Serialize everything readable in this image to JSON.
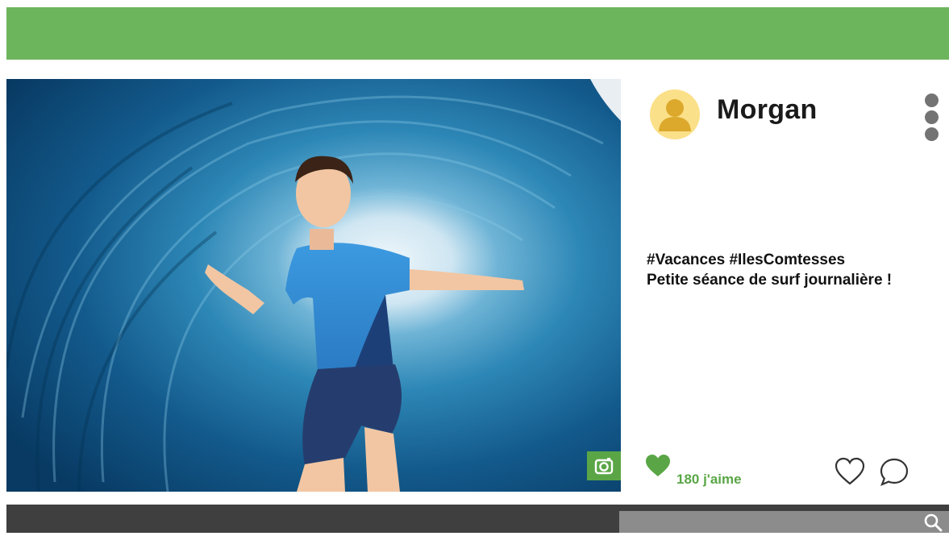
{
  "header": {},
  "post": {
    "author": "Morgan",
    "caption_line1": "#Vacances #IlesComtesses",
    "caption_line2": "Petite séance de surf journalière !",
    "likes_text": "180 j'aime",
    "photo_icon": "camera-icon",
    "avatar_icon": "user-avatar-icon"
  },
  "actions": {
    "like_icon": "heart-filled-icon",
    "favorite_icon": "heart-outline-icon",
    "comment_icon": "comment-bubble-icon",
    "menu_icon": "vertical-ellipsis-icon"
  },
  "search": {
    "placeholder": "",
    "icon": "search-icon"
  },
  "colors": {
    "brand_green": "#6db55c",
    "accent_green": "#5aa646",
    "avatar_bg": "#fbe08a",
    "avatar_fg": "#dca92c",
    "footer_bar": "#3f3f3f",
    "search_bg": "#8c8c8c"
  }
}
